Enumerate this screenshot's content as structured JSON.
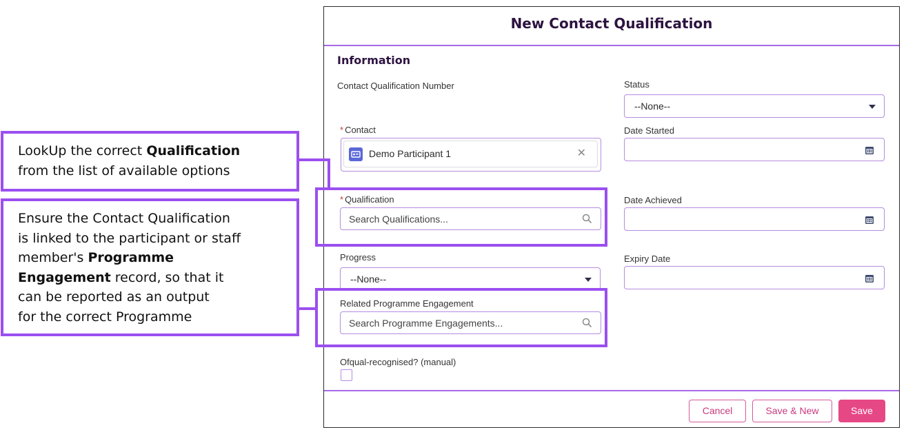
{
  "modal": {
    "title": "New Contact Qualification",
    "section": "Information",
    "fields": {
      "cq_number": {
        "label": "Contact Qualification Number"
      },
      "status": {
        "label": "Status",
        "value": "--None--"
      },
      "contact": {
        "label": "Contact",
        "value": "Demo Participant 1"
      },
      "date_started": {
        "label": "Date Started"
      },
      "qualification": {
        "label": "Qualification",
        "placeholder": "Search Qualifications..."
      },
      "date_achieved": {
        "label": "Date Achieved"
      },
      "progress": {
        "label": "Progress",
        "value": "--None--"
      },
      "expiry_date": {
        "label": "Expiry Date"
      },
      "programme_engagement": {
        "label": "Related Programme Engagement",
        "placeholder": "Search Programme Engagements..."
      },
      "ofqual": {
        "label": "Ofqual-recognised? (manual)",
        "checked": false
      }
    },
    "required_marker": "*",
    "buttons": {
      "cancel": "Cancel",
      "save_new": "Save & New",
      "save": "Save"
    }
  },
  "callouts": {
    "qualification": [
      {
        "text": "LookUp the correct ",
        "bold": "Qualification"
      },
      {
        "text": "from the list of available options"
      }
    ],
    "engagement": [
      {
        "text": "Ensure the Contact Qualification"
      },
      {
        "text": "is linked to the participant or staff"
      },
      {
        "text": "member's ",
        "bold": "Programme"
      },
      {
        "bold": "Engagement",
        "text": " record, so that it"
      },
      {
        "text": "can be reported as an output"
      },
      {
        "text": "for the correct Programme"
      }
    ]
  },
  "colors": {
    "accent": "#9b4ff0",
    "field_border": "#b58be0",
    "primary_button": "#e64886",
    "title": "#2d1340"
  },
  "icons": {
    "calendar": "calendar-icon",
    "search": "search-icon",
    "caret": "chevron-down-icon",
    "contact": "contact-card-icon",
    "clear": "close-icon"
  }
}
